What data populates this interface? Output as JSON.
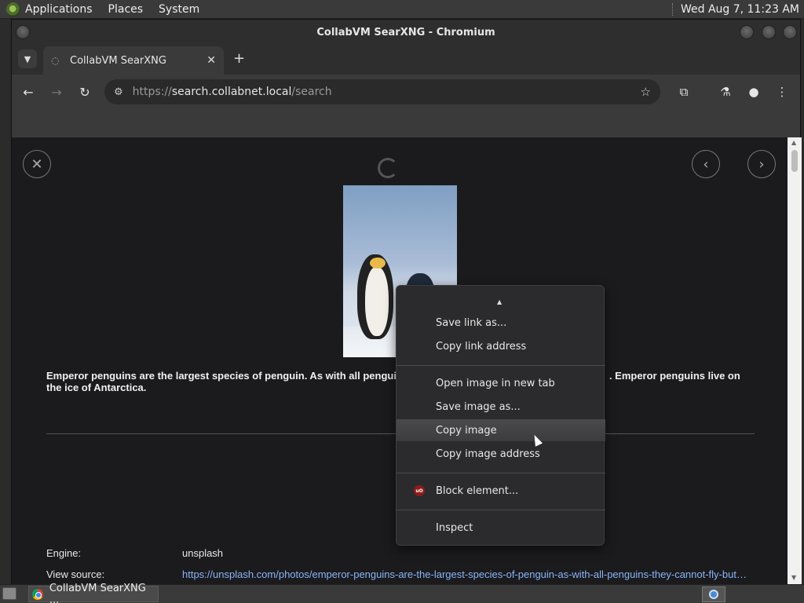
{
  "top_panel": {
    "menus": [
      "Applications",
      "Places",
      "System"
    ],
    "clock": "Wed Aug  7, 11:23 AM"
  },
  "window": {
    "title": "CollabVM SearXNG - Chromium"
  },
  "tab": {
    "title": "CollabVM SearXNG",
    "close": "✕",
    "new_tab": "+"
  },
  "omnibox": {
    "scheme": "https://",
    "host": "search.collabnet.local",
    "path": "/search"
  },
  "content": {
    "description": "Emperor penguins are the largest species of penguin. As with all penguins they cannot fly but ... . Emperor penguins live on the ice of Antarctica.",
    "description_line1_left": "Emperor penguins are the largest species of penguin. As with all pengui",
    "description_line1_right": ". Emperor penguins live on",
    "description_line2": "the ice of Antarctica.",
    "engine_label": "Engine:",
    "engine_value": "unsplash",
    "source_label": "View source:",
    "source_value": "https://unsplash.com/photos/emperor-penguins-are-the-largest-species-of-penguin-as-with-all-penguins-they-cannot-fly-but-..."
  },
  "context_menu": {
    "items": [
      "Save link as...",
      "Copy link address",
      "Open image in new tab",
      "Save image as...",
      "Copy image",
      "Copy image address",
      "Block element...",
      "Inspect"
    ],
    "highlighted": "Copy image"
  },
  "taskbar": {
    "task_title": "CollabVM SearXNG ..."
  }
}
